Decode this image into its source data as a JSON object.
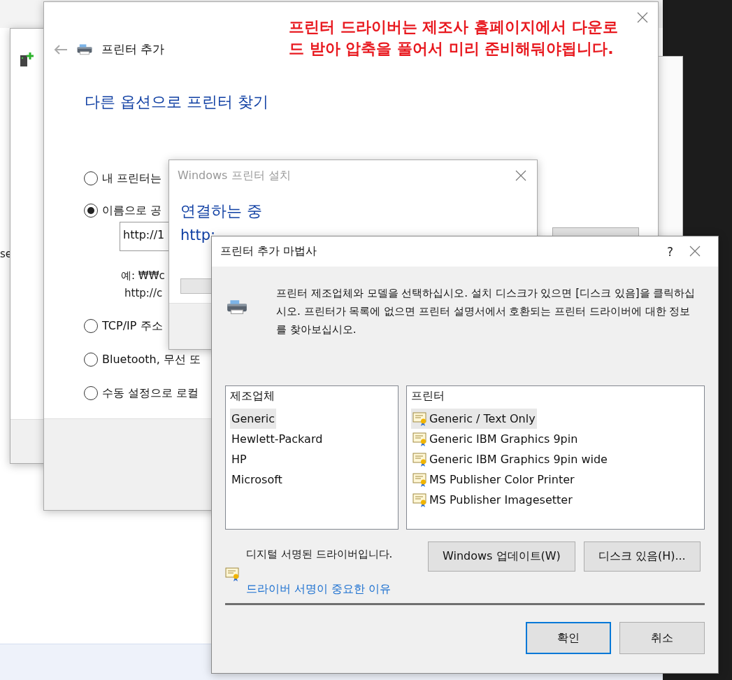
{
  "background_window": {
    "edge_text": "se"
  },
  "add_printer_window": {
    "title": "프린터 추가",
    "heading": "다른 옵션으로 프린터 찾기",
    "note": "프린터 드라이버는 제조사 홈페이지에서 다운로드 받아 압축을 풀어서 미리 준비해둬야됩니다.",
    "options": [
      {
        "label": "내 프린터는",
        "selected": false
      },
      {
        "label": "이름으로 공",
        "selected": true,
        "field_value": "http://1",
        "examples": [
          "예: ₩₩c",
          "http://c"
        ]
      },
      {
        "label": "TCP/IP 주소",
        "selected": false
      },
      {
        "label": "Bluetooth, 무선 또",
        "selected": false
      },
      {
        "label": "수동 설정으로 로컬",
        "selected": false
      }
    ]
  },
  "install_window": {
    "title": "Windows 프린터 설치",
    "status": "연결하는 중",
    "url": "http:",
    "progress": {
      "level": 0
    }
  },
  "wizard": {
    "title": "프린터 추가 마법사",
    "help": "?",
    "description": "프린터 제조업체와 모델을 선택하십시오. 설치 디스크가 있으면 [디스크 있음]을 클릭하십시오. 프린터가 목록에 없으면 프린터 설명서에서 호환되는 프린터 드라이버에 대한 정보를 찾아보십시오.",
    "manufacturers": {
      "header": "제조업체",
      "items": [
        {
          "label": "Generic",
          "selected": true
        },
        {
          "label": "Hewlett-Packard",
          "selected": false
        },
        {
          "label": "HP",
          "selected": false
        },
        {
          "label": "Microsoft",
          "selected": false
        }
      ]
    },
    "printers": {
      "header": "프린터",
      "items": [
        {
          "label": "Generic / Text Only",
          "selected": true
        },
        {
          "label": "Generic IBM Graphics 9pin",
          "selected": false
        },
        {
          "label": "Generic IBM Graphics 9pin wide",
          "selected": false
        },
        {
          "label": "MS Publisher Color Printer",
          "selected": false
        },
        {
          "label": "MS Publisher Imagesetter",
          "selected": false
        }
      ]
    },
    "signed_text": "디지털 서명된 드라이버입니다.",
    "signed_link": "드라이버 서명이 중요한 이유",
    "tool_buttons": [
      "Windows 업데이트(W)",
      "디스크 있음(H)..."
    ],
    "dialog_buttons": [
      {
        "label": "확인",
        "default": true
      },
      {
        "label": "취소",
        "default": false
      }
    ]
  }
}
